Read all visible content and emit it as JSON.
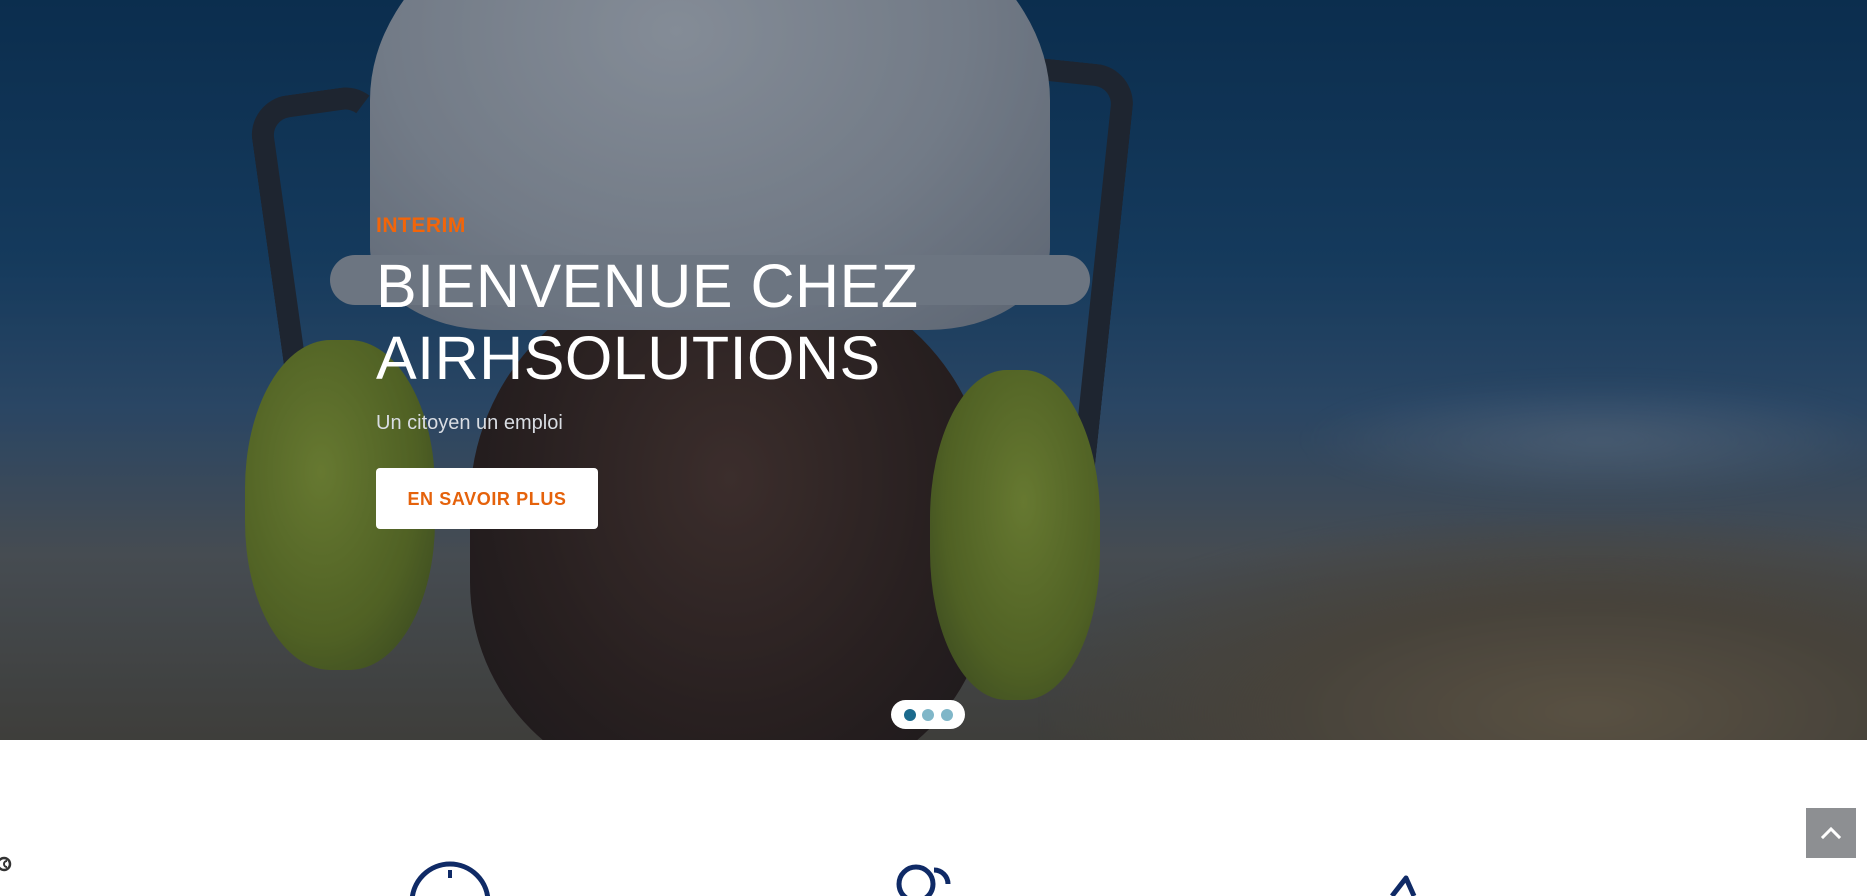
{
  "hero": {
    "kicker": "INTERIM",
    "headline_line1": "BIENVENUE CHEZ",
    "headline_line2": "AIRHSOLUTIONS",
    "subline": "Un citoyen un emploi",
    "cta_label": "EN SAVOIR PLUS"
  },
  "slider": {
    "slides": 3,
    "active_index": 0
  },
  "scroll_top": {
    "icon": "chevron-up-icon"
  },
  "features": {
    "icons": [
      "clock-icon",
      "people-icon",
      "megaphone-icon"
    ]
  },
  "colors": {
    "accent_orange": "#f2650a",
    "dot_active": "#1b6a8d",
    "dot_inactive": "#7fb6c8",
    "icon_navy": "#0f2a66",
    "scroll_button": "#8d8f92"
  }
}
